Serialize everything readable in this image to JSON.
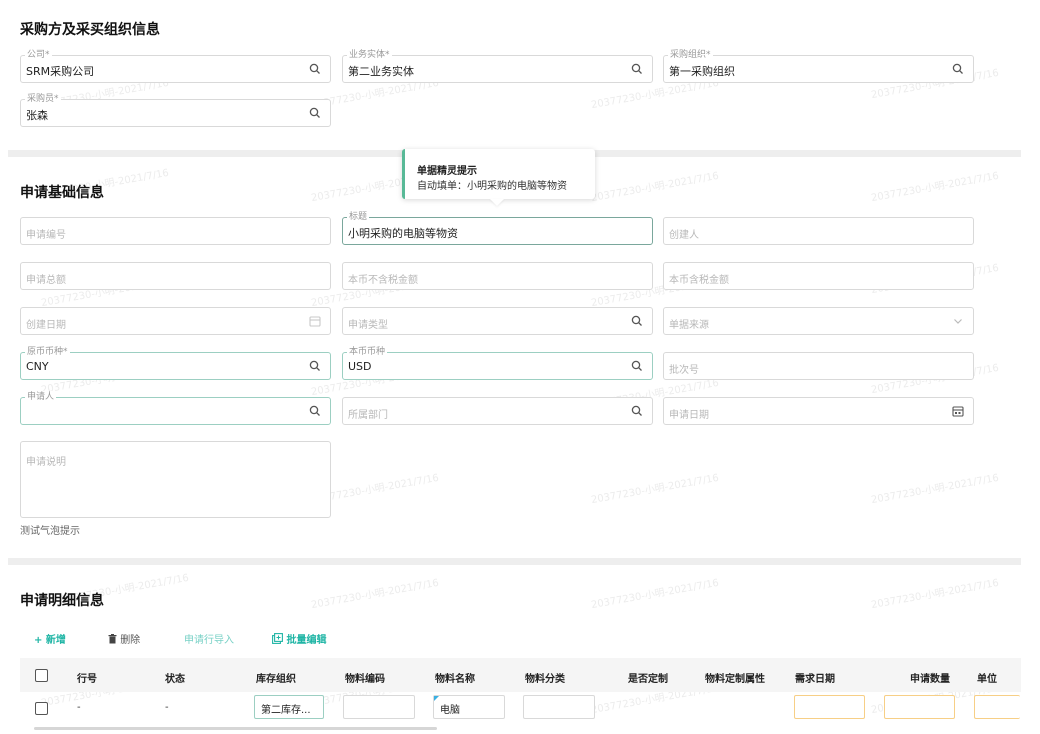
{
  "section1": {
    "title": "采购方及采买组织信息",
    "company": {
      "label": "公司",
      "value": "SRM采购公司"
    },
    "business_entity": {
      "label": "业务实体",
      "value": "第二业务实体"
    },
    "purchase_org": {
      "label": "采购组织",
      "value": "第一采购组织"
    },
    "buyer": {
      "label": "采购员",
      "value": "张森"
    },
    "required_mark": "*"
  },
  "section2": {
    "title": "申请基础信息",
    "request_no": {
      "placeholder": "申请编号"
    },
    "subject": {
      "label": "标题",
      "value": "小明采购的电脑等物资"
    },
    "creator": {
      "placeholder": "创建人"
    },
    "total_amount": {
      "placeholder": "申请总额"
    },
    "local_excl_tax": {
      "placeholder": "本币不含税金额"
    },
    "local_incl_tax": {
      "placeholder": "本币含税金额"
    },
    "create_date": {
      "placeholder": "创建日期"
    },
    "request_type": {
      "placeholder": "申请类型"
    },
    "doc_source": {
      "placeholder": "单据来源"
    },
    "source_currency": {
      "label": "原币币种",
      "value": "CNY"
    },
    "local_currency": {
      "label": "本币币种",
      "value": "USD"
    },
    "batch_no": {
      "placeholder": "批次号"
    },
    "applicant": {
      "label": "申请人",
      "value": ""
    },
    "department": {
      "placeholder": "所属部门"
    },
    "request_date": {
      "placeholder": "申请日期"
    },
    "description": {
      "placeholder": "申请说明"
    },
    "bubble_hint": "测试气泡提示"
  },
  "tooltip": {
    "title": "单据精灵提示",
    "body": "自动填单：小明采购的电脑等物资"
  },
  "section3": {
    "title": "申请明细信息",
    "toolbar": {
      "add": "新增",
      "delete": "删除",
      "import": "申请行导入",
      "batch_edit": "批量编辑"
    },
    "columns": [
      "行号",
      "状态",
      "库存组织",
      "物料编码",
      "物料名称",
      "物料分类",
      "是否定制",
      "物料定制属性",
      "需求日期",
      "申请数量",
      "单位"
    ],
    "row": {
      "line_no": "-",
      "status": "-",
      "inventory_org": "第二库存...",
      "material_code": "",
      "material_name": "电脑",
      "material_category": ""
    }
  },
  "watermark": "20377230-小明-2021/7/16",
  "colors": {
    "accent": "#1fb5a5",
    "active_border": "#9ccfc2",
    "tooltip_border": "#58b997",
    "required_border": "#f7cf86"
  },
  "icons": {
    "search": "search-icon",
    "calendar": "calendar-icon",
    "chevron": "chevron-down-icon",
    "add": "plus-icon",
    "delete": "trash-icon",
    "batch": "batch-edit-icon"
  }
}
